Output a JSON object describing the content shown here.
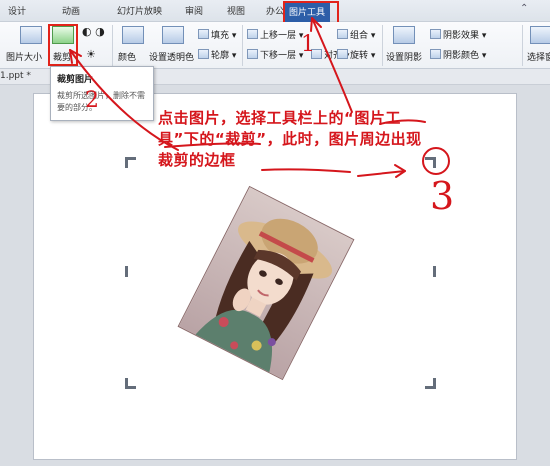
{
  "tabs": [
    "设计",
    "动画",
    "幻灯片放映",
    "审阅",
    "视图",
    "办公空间",
    "图片工具"
  ],
  "active_tab": "图片工具",
  "ribbon": {
    "image_size": "图片大小",
    "crop": "裁剪",
    "color": "颜色",
    "set_transparent": "设置透明色",
    "fill": "填充",
    "outline": "轮廓",
    "bring_forward": "上移一层",
    "send_backward": "下移一层",
    "align": "对齐",
    "group": "组合",
    "rotate": "旋转",
    "set_shadow": "设置阴影",
    "shadow_effect": "阴影效果",
    "shadow_color": "阴影颜色",
    "select_pane": "选择窗"
  },
  "document": {
    "filename": "1.ppt *"
  },
  "tooltip": {
    "title": "裁剪图片",
    "description": "裁剪所选图片，删除不需要的部分。"
  },
  "annotation": {
    "text": "点击图片，选择工具栏上的“图片工具”下的“裁剪”，此时，图片周边出现裁剪的边框"
  },
  "markers": [
    "1",
    "2",
    "3"
  ],
  "colors": {
    "annotation_red": "#d5161c",
    "active_tab_blue": "#2d5ea8"
  }
}
